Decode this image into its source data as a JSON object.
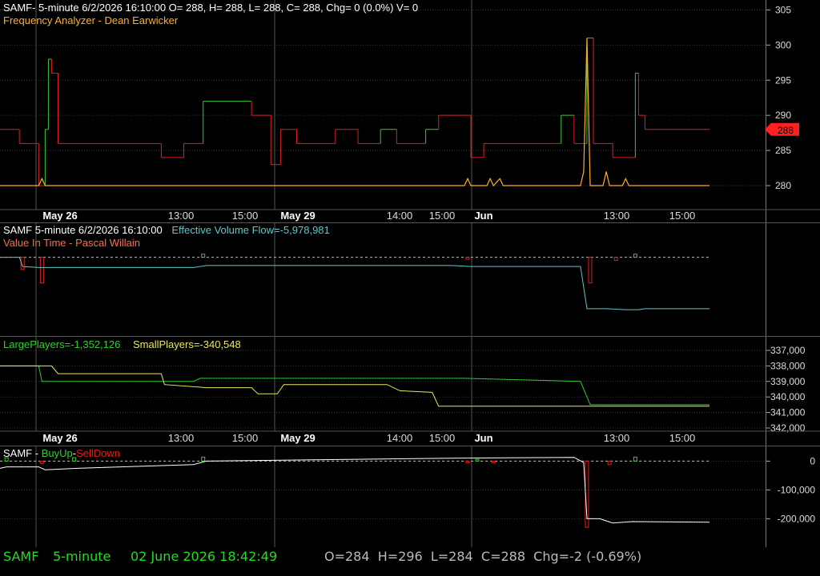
{
  "colors": {
    "background": "#000000",
    "grid": "#3a3a3a",
    "axis_text": "#dddddd",
    "header_white": "#ffffff",
    "orange": "#ffb020",
    "red": "#e02020",
    "green": "#33cc33",
    "cyan": "#5ec8c8",
    "yellow": "#e8e860",
    "status_green": "#22dd22",
    "status_gray": "#bbbbbb"
  },
  "header": {
    "symbol_line": "SAMF- 5-minute 6/2/2026 16:10:00 O= 288, H= 288, L= 288, C= 288, Chg= 0 (0.0%) V= 0",
    "study_line": "Frequency Analyzer - Dean Earwicker"
  },
  "pane2_header": {
    "symbol_line": "SAMF 5-minute  6/2/2026 16:10:00",
    "flow_label": "Effective Volume Flow=-5,978,981",
    "study_line": "Value In Time - Pascal Willain"
  },
  "pane3_header": {
    "large_label": "LargePlayers=-1,352,126",
    "small_label": "SmallPlayers=-340,548"
  },
  "pane4_header": {
    "sym": "SAMF",
    "dash1": " - ",
    "buy": "BuyUp",
    "dash2": "-",
    "sell": "SellDown"
  },
  "price_marker": "288",
  "time_axis": {
    "labels": [
      {
        "text": "May 26",
        "bold": true
      },
      {
        "text": "13:00",
        "bold": false
      },
      {
        "text": "15:00",
        "bold": false
      },
      {
        "text": "May 29",
        "bold": true
      },
      {
        "text": "14:00",
        "bold": false
      },
      {
        "text": "15:00",
        "bold": false
      },
      {
        "text": "Jun",
        "bold": true
      },
      {
        "text": "13:00",
        "bold": false
      },
      {
        "text": "15:00",
        "bold": false
      }
    ]
  },
  "status": {
    "symbol": "SAMF",
    "interval": "5-minute",
    "datetime": "02 June 2026 18:42:49",
    "ohlc": "O=284  H=296  L=284  C=288  Chg=-2 (-0.69%)"
  },
  "chart_data": [
    {
      "type": "line",
      "title": "Frequency Analyzer - Dean Earwicker",
      "ylim": [
        277,
        306
      ],
      "y_ticks": [
        "305",
        "300",
        "295",
        "290",
        "285",
        "280"
      ],
      "grid": true,
      "x_index": [
        0,
        3,
        6,
        9,
        12,
        15,
        18,
        24,
        30,
        36,
        42,
        48,
        54,
        60,
        66,
        72,
        78,
        84,
        90,
        96,
        102,
        108,
        114,
        120,
        126,
        132,
        138,
        144,
        150,
        156,
        162,
        168,
        174,
        180,
        186,
        192,
        198,
        204,
        210,
        216,
        220
      ],
      "series": [
        {
          "name": "price",
          "steps": [
            {
              "x0": 0,
              "x1": 6,
              "y": 288,
              "c": "red"
            },
            {
              "x0": 6,
              "x1": 12,
              "y": 286,
              "c": "red"
            },
            {
              "x0": 12,
              "x1": 14,
              "y": 280,
              "c": "red"
            },
            {
              "x0": 14,
              "x1": 15,
              "y": 288,
              "c": "green"
            },
            {
              "x0": 15,
              "x1": 16,
              "y": 298,
              "c": "green"
            },
            {
              "x0": 16,
              "x1": 18,
              "y": 296,
              "c": "red"
            },
            {
              "x0": 18,
              "x1": 50,
              "y": 286,
              "c": "red"
            },
            {
              "x0": 50,
              "x1": 57,
              "y": 284,
              "c": "red"
            },
            {
              "x0": 57,
              "x1": 63,
              "y": 286,
              "c": "red"
            },
            {
              "x0": 63,
              "x1": 78,
              "y": 292,
              "c": "green"
            },
            {
              "x0": 78,
              "x1": 84,
              "y": 290,
              "c": "red"
            },
            {
              "x0": 84,
              "x1": 87,
              "y": 283,
              "c": "red"
            },
            {
              "x0": 87,
              "x1": 92,
              "y": 288,
              "c": "red"
            },
            {
              "x0": 92,
              "x1": 104,
              "y": 286,
              "c": "red"
            },
            {
              "x0": 104,
              "x1": 111,
              "y": 288,
              "c": "red"
            },
            {
              "x0": 111,
              "x1": 118,
              "y": 286,
              "c": "red"
            },
            {
              "x0": 118,
              "x1": 123,
              "y": 288,
              "c": "green"
            },
            {
              "x0": 123,
              "x1": 132,
              "y": 286,
              "c": "red"
            },
            {
              "x0": 132,
              "x1": 136,
              "y": 288,
              "c": "green"
            },
            {
              "x0": 136,
              "x1": 146,
              "y": 290,
              "c": "red"
            },
            {
              "x0": 146,
              "x1": 150,
              "y": 284,
              "c": "red"
            },
            {
              "x0": 150,
              "x1": 162,
              "y": 286,
              "c": "red"
            },
            {
              "x0": 162,
              "x1": 174,
              "y": 286,
              "c": "red"
            },
            {
              "x0": 174,
              "x1": 178,
              "y": 290,
              "c": "green"
            },
            {
              "x0": 178,
              "x1": 182,
              "y": 286,
              "c": "red"
            },
            {
              "x0": 182,
              "x1": 184,
              "y": 301,
              "c": "green"
            },
            {
              "x0": 184,
              "x1": 190,
              "y": 286,
              "c": "red"
            },
            {
              "x0": 190,
              "x1": 197,
              "y": 284,
              "c": "red"
            },
            {
              "x0": 197,
              "x1": 198,
              "y": 296,
              "c": "green"
            },
            {
              "x0": 198,
              "x1": 200,
              "y": 290,
              "c": "red"
            },
            {
              "x0": 200,
              "x1": 220,
              "y": 288,
              "c": "red"
            }
          ]
        },
        {
          "name": "frequency",
          "points": [
            [
              0,
              280
            ],
            [
              10,
              280
            ],
            [
              12,
              280
            ],
            [
              13,
              281
            ],
            [
              14,
              280
            ],
            [
              60,
              280
            ],
            [
              80,
              280
            ],
            [
              100,
              280
            ],
            [
              144,
              280
            ],
            [
              145,
              281
            ],
            [
              146,
              280
            ],
            [
              151,
              280
            ],
            [
              152,
              281
            ],
            [
              153,
              280
            ],
            [
              155,
              281
            ],
            [
              156,
              280
            ],
            [
              178,
              280
            ],
            [
              180,
              280
            ],
            [
              181,
              282
            ],
            [
              182,
              301
            ],
            [
              183,
              280
            ],
            [
              187,
              280
            ],
            [
              188,
              282
            ],
            [
              189,
              280
            ],
            [
              193,
              280
            ],
            [
              194,
              281
            ],
            [
              195,
              280
            ],
            [
              220,
              280
            ]
          ]
        }
      ]
    },
    {
      "type": "line",
      "title": "Value In Time - Pascal Willain",
      "ylim": [
        -6500000,
        1000000
      ],
      "series": [
        {
          "name": "Effective Volume Flow",
          "points": [
            [
              0,
              0
            ],
            [
              6,
              0
            ],
            [
              7,
              -900000
            ],
            [
              12,
              -1000000
            ],
            [
              60,
              -1000000
            ],
            [
              64,
              -800000
            ],
            [
              140,
              -800000
            ],
            [
              146,
              -900000
            ],
            [
              180,
              -900000
            ],
            [
              182,
              -5000000
            ],
            [
              188,
              -5000000
            ],
            [
              194,
              -5100000
            ],
            [
              198,
              -5100000
            ],
            [
              200,
              -5000000
            ],
            [
              220,
              -5000000
            ]
          ]
        },
        {
          "name": "daily_bars",
          "values": [
            [
              7,
              -1200000
            ],
            [
              13,
              -2500000
            ],
            [
              63,
              300000
            ],
            [
              145,
              -200000
            ],
            [
              183,
              -2500000
            ],
            [
              191,
              -300000
            ],
            [
              197,
              300000
            ]
          ]
        }
      ]
    },
    {
      "type": "line",
      "title": "",
      "ylim": [
        -342500,
        -336500
      ],
      "y_ticks": [
        "337,000",
        "338,000",
        "339,000",
        "340,000",
        "341,000",
        "342,000"
      ],
      "series": [
        {
          "name": "LargePlayers",
          "points": [
            [
              0,
              -338000
            ],
            [
              12,
              -338000
            ],
            [
              13,
              -339000
            ],
            [
              60,
              -339000
            ],
            [
              62,
              -338800
            ],
            [
              144,
              -338800
            ],
            [
              180,
              -339000
            ],
            [
              183,
              -340500
            ],
            [
              220,
              -340500
            ]
          ]
        },
        {
          "name": "SmallPlayers",
          "points": [
            [
              0,
              -338000
            ],
            [
              16,
              -338000
            ],
            [
              18,
              -338500
            ],
            [
              50,
              -338500
            ],
            [
              51,
              -339200
            ],
            [
              64,
              -339400
            ],
            [
              78,
              -339400
            ],
            [
              80,
              -339800
            ],
            [
              86,
              -339800
            ],
            [
              88,
              -339200
            ],
            [
              120,
              -339200
            ],
            [
              124,
              -339600
            ],
            [
              134,
              -339700
            ],
            [
              136,
              -340600
            ],
            [
              220,
              -340600
            ]
          ]
        }
      ]
    },
    {
      "type": "line",
      "title": "",
      "ylim": [
        -260000,
        40000
      ],
      "y_ticks": [
        "0",
        "100,000",
        "200,000"
      ],
      "series": [
        {
          "name": "BuyUp",
          "values": [
            [
              2,
              12000
            ],
            [
              23,
              12000
            ],
            [
              63,
              14000
            ],
            [
              148,
              6000
            ],
            [
              197,
              14000
            ]
          ]
        },
        {
          "name": "SellDown",
          "values": [
            [
              13,
              -8000
            ],
            [
              145,
              -4000
            ],
            [
              153,
              -4000
            ],
            [
              182,
              -230000
            ],
            [
              189,
              -12000
            ]
          ]
        },
        {
          "name": "net",
          "points": [
            [
              0,
              -25000
            ],
            [
              2,
              -20000
            ],
            [
              12,
              -20000
            ],
            [
              14,
              -30000
            ],
            [
              24,
              -25000
            ],
            [
              60,
              -12000
            ],
            [
              64,
              0
            ],
            [
              100,
              5000
            ],
            [
              140,
              10000
            ],
            [
              178,
              13000
            ],
            [
              181,
              -5000
            ],
            [
              182,
              -200000
            ],
            [
              186,
              -200000
            ],
            [
              190,
              -215000
            ],
            [
              196,
              -210000
            ],
            [
              220,
              -212000
            ]
          ]
        }
      ]
    }
  ]
}
